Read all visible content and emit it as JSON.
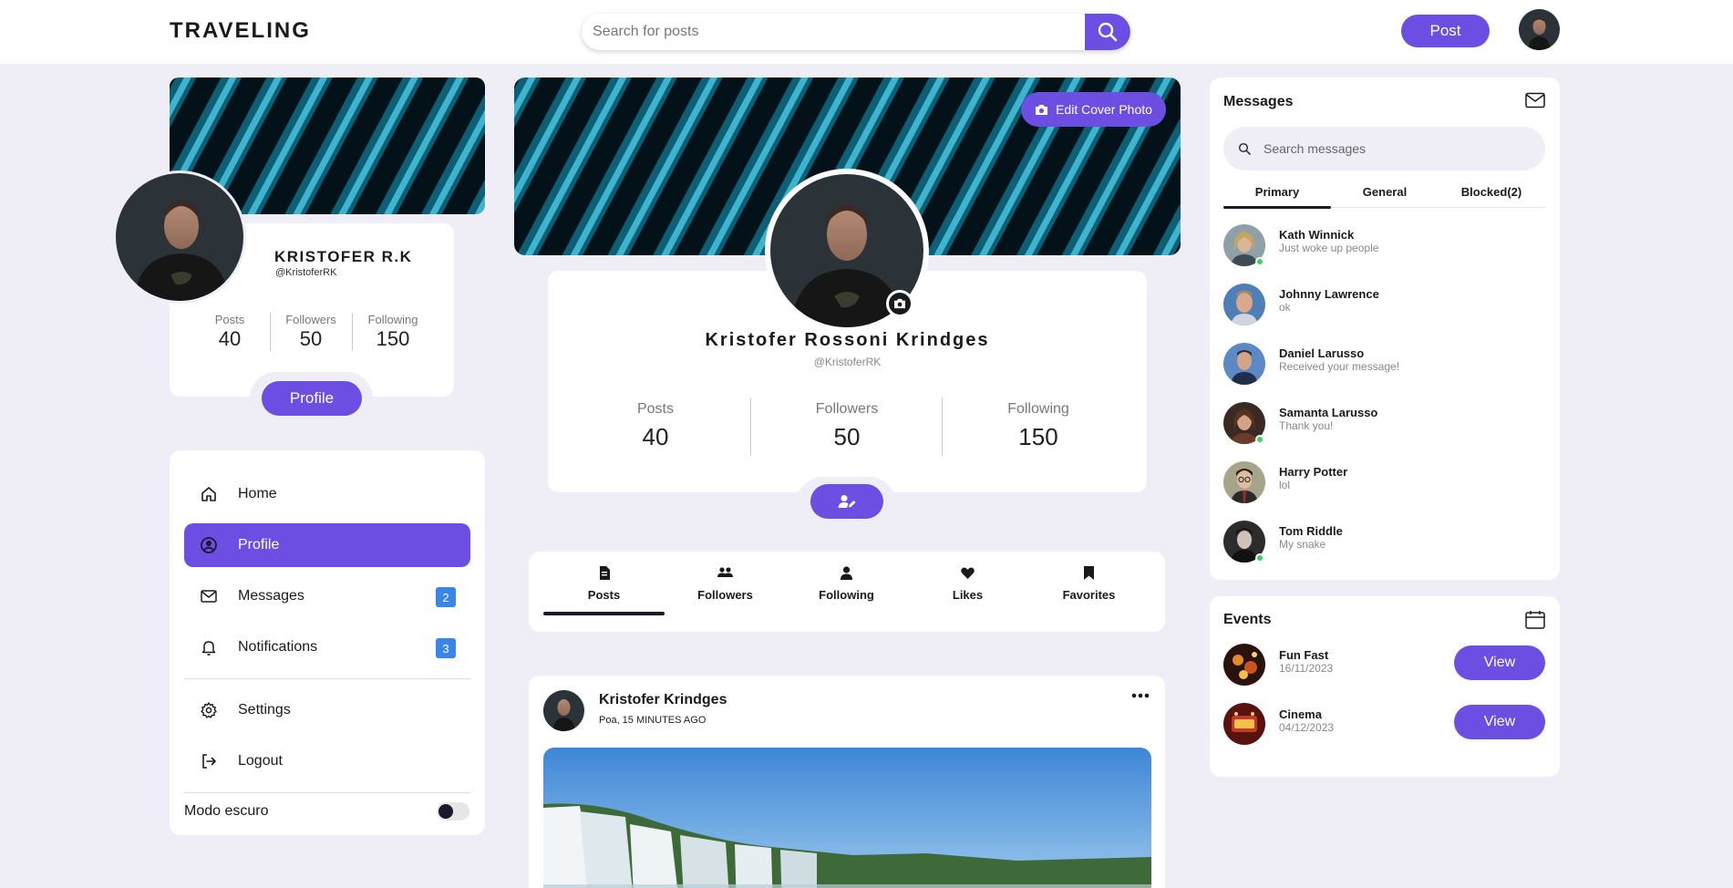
{
  "header": {
    "brand": "TRAVELING",
    "search_placeholder": "Search for posts",
    "post_label": "Post"
  },
  "left_profile": {
    "name": "KRISTOFER R.K",
    "handle": "@KristoferRK",
    "stats": [
      {
        "label": "Posts",
        "value": "40"
      },
      {
        "label": "Followers",
        "value": "50"
      },
      {
        "label": "Following",
        "value": "150"
      }
    ],
    "profile_button": "Profile"
  },
  "nav": {
    "items": [
      {
        "label": "Home",
        "icon": "home-icon"
      },
      {
        "label": "Profile",
        "icon": "user-circle-icon",
        "active": true
      },
      {
        "label": "Messages",
        "icon": "mail-icon",
        "badge": "2"
      },
      {
        "label": "Notifications",
        "icon": "bell-icon",
        "badge": "3"
      },
      {
        "label": "Settings",
        "icon": "gear-icon"
      },
      {
        "label": "Logout",
        "icon": "logout-icon"
      }
    ],
    "dark_mode_label": "Modo escuro"
  },
  "profile": {
    "edit_cover_label": "Edit Cover Photo",
    "name": "Kristofer Rossoni Krindges",
    "handle": "@KristoferRK",
    "stats": [
      {
        "label": "Posts",
        "value": "40"
      },
      {
        "label": "Followers",
        "value": "50"
      },
      {
        "label": "Following",
        "value": "150"
      }
    ]
  },
  "tabs": [
    {
      "label": "Posts",
      "icon": "document-icon",
      "active": true
    },
    {
      "label": "Followers",
      "icon": "users-icon"
    },
    {
      "label": "Following",
      "icon": "user-icon"
    },
    {
      "label": "Likes",
      "icon": "heart-icon"
    },
    {
      "label": "Favorites",
      "icon": "bookmark-icon"
    }
  ],
  "post": {
    "author": "Kristofer Krindges",
    "meta": "Poa, 15 MINUTES AGO",
    "more": "..."
  },
  "messages": {
    "title": "Messages",
    "search_placeholder": "Search messages",
    "tabs": [
      "Primary",
      "General",
      "Blocked(2)"
    ],
    "contacts": [
      {
        "name": "Kath Winnick",
        "text": "Just woke up people",
        "online": true
      },
      {
        "name": "Johnny Lawrence",
        "text": "ok",
        "online": false
      },
      {
        "name": "Daniel Larusso",
        "text": "Received your message!",
        "online": false
      },
      {
        "name": "Samanta Larusso",
        "text": "Thank you!",
        "online": true
      },
      {
        "name": "Harry Potter",
        "text": "lol",
        "online": false
      },
      {
        "name": "Tom Riddle",
        "text": "My snake",
        "online": true
      }
    ]
  },
  "events": {
    "title": "Events",
    "items": [
      {
        "name": "Fun Fast",
        "date": "16/11/2023",
        "action": "View"
      },
      {
        "name": "Cinema",
        "date": "04/12/2023",
        "action": "View"
      }
    ]
  },
  "colors": {
    "accent": "#6c4ee3",
    "background": "#efeef7",
    "badge": "#3a86e8",
    "online": "#38d35a"
  }
}
